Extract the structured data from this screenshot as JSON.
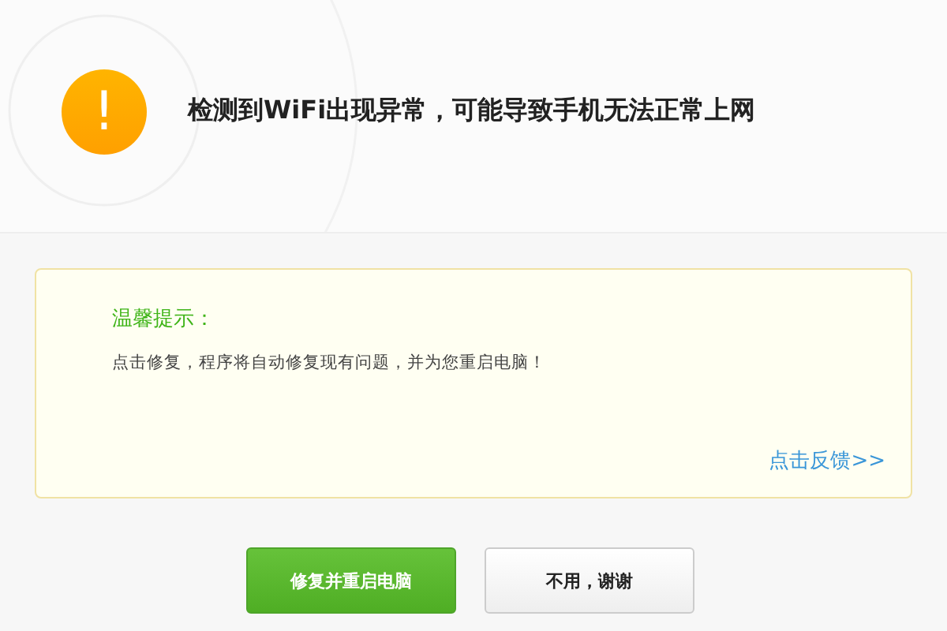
{
  "alert": {
    "icon": "!",
    "message": "检测到WiFi出现异常，可能导致手机无法正常上网"
  },
  "notice": {
    "title": "温馨提示：",
    "body": "点击修复，程序将自动修复现有问题，并为您重启电脑！",
    "link": "点击反馈>>"
  },
  "buttons": [
    {
      "label": "修复并重启电脑",
      "kind": "primary"
    },
    {
      "label": "不用，谢谢",
      "kind": "secondary"
    }
  ]
}
